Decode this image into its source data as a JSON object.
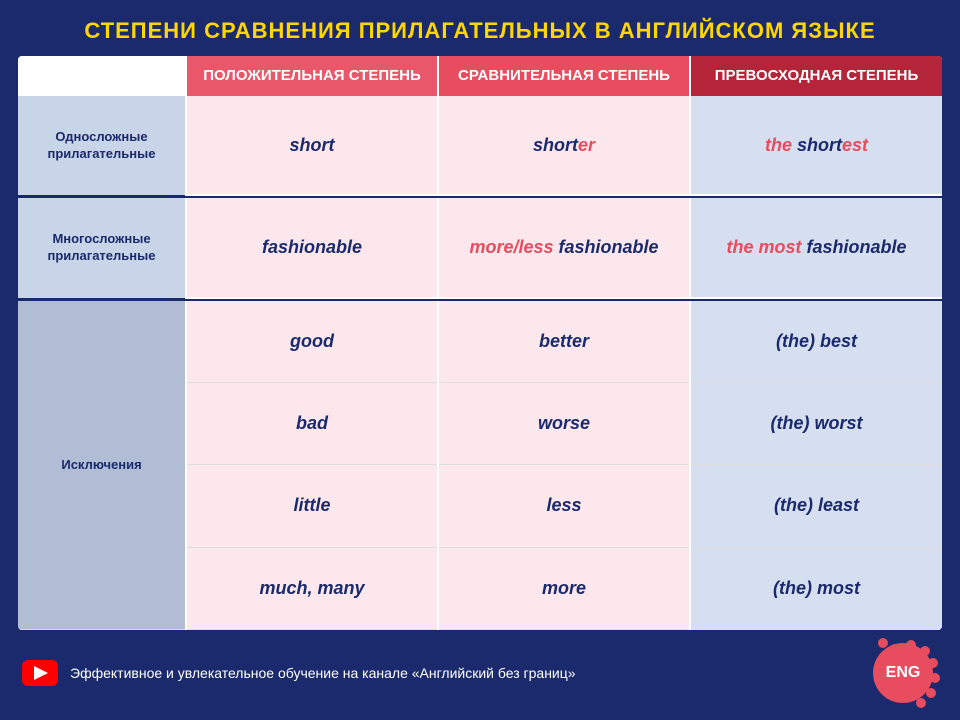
{
  "title": "СТЕПЕНИ СРАВНЕНИЯ ПРИЛАГАТЕЛЬНЫХ В АНГЛИЙСКОМ ЯЗЫКЕ",
  "headers": {
    "label": "",
    "positive": "ПОЛОЖИТЕЛЬНАЯ СТЕПЕНЬ",
    "comparative": "СРАВНИТЕЛЬНАЯ СТЕПЕНЬ",
    "superlative": "ПРЕВОСХОДНАЯ СТЕПЕНЬ"
  },
  "categories": {
    "monosyllabic": "Односложные\nприлагательные",
    "polysyllabic": "Многосложные\nприлагательные",
    "exceptions": "Исключения"
  },
  "rows": {
    "monosyllabic": {
      "positive": "short",
      "comparative_plain": "short",
      "comparative_suffix": "er",
      "superlative_the": "the ",
      "superlative_plain": "short",
      "superlative_suffix": "est"
    },
    "polysyllabic": {
      "positive": "fashionable",
      "comparative_prefix": "more/less ",
      "comparative_word": "fashionable",
      "superlative_the": "the most ",
      "superlative_word": "fashionable"
    },
    "exceptions": [
      {
        "positive": "good",
        "comparative": "better",
        "superlative": "(the) best"
      },
      {
        "positive": "bad",
        "comparative": "worse",
        "superlative": "(the) worst"
      },
      {
        "positive": "little",
        "comparative": "less",
        "superlative": "(the) least"
      },
      {
        "positive": "much, many",
        "comparative": "more",
        "superlative": "(the) most"
      }
    ]
  },
  "footer": {
    "text": "Эффективное и увлекательное обучение на канале «Английский без границ»",
    "logo": "ENG"
  }
}
